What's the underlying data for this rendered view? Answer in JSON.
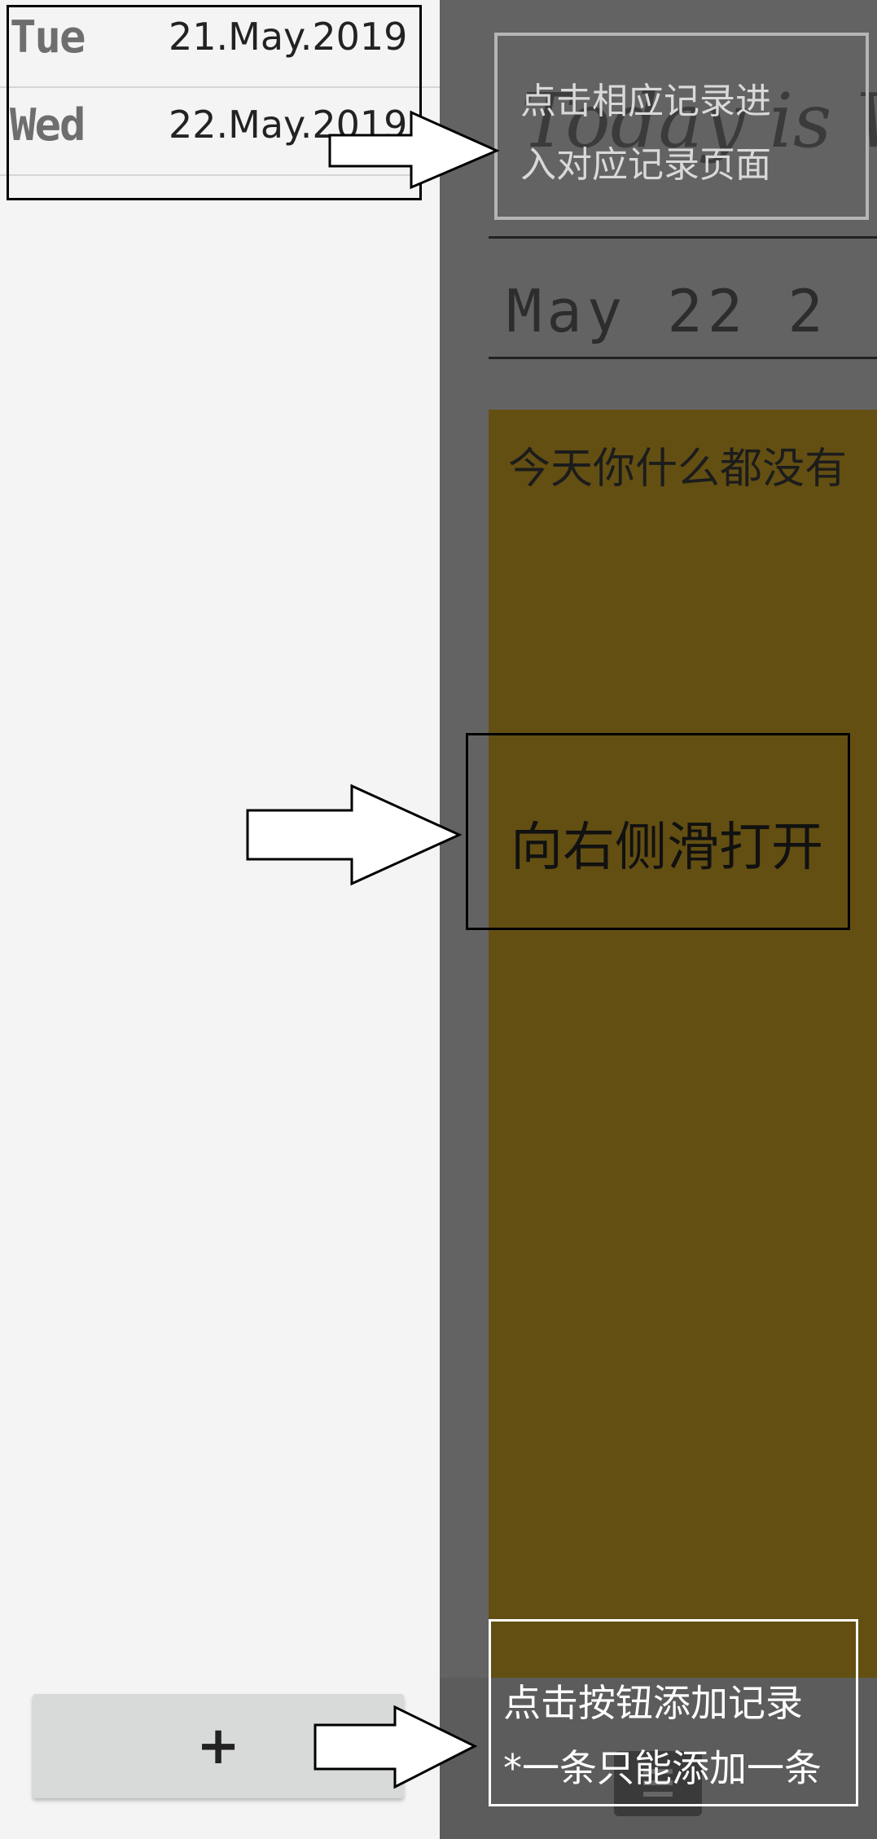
{
  "drawer": {
    "entries": [
      {
        "day": "Tue",
        "date": "21.May.2019"
      },
      {
        "day": "Wed",
        "date": "22.May.2019"
      }
    ],
    "add_button_label": "+"
  },
  "main": {
    "title": "Today is W",
    "date_text": "May 22  2",
    "note_text": "今天你什么都没有"
  },
  "annotations": {
    "tap_record": [
      "点击相应记录进",
      "入对应记录页面"
    ],
    "swipe_open": "向右侧滑打开",
    "add_button": [
      "点击按钮添加记录",
      "*一条只能添加一条"
    ]
  },
  "colors": {
    "drawer_bg": "#f4f4f4",
    "main_overlay": "#636363",
    "note_bg": "#634f12"
  }
}
